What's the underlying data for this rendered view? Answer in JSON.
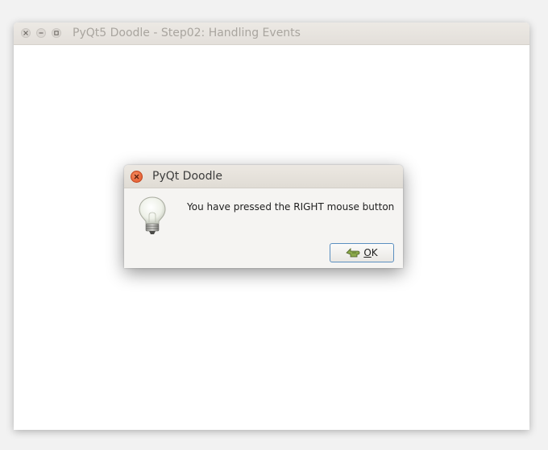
{
  "main_window": {
    "title": "PyQt5 Doodle - Step02: Handling Events",
    "buttons": {
      "close_icon": "close-icon",
      "minimize_icon": "minimize-icon",
      "maximize_icon": "maximize-icon"
    }
  },
  "dialog": {
    "title": "PyQt Doodle",
    "message": "You have pressed the RIGHT mouse button",
    "icon": "lightbulb-icon",
    "ok_button": {
      "mnemonic": "O",
      "rest": "K",
      "icon": "ok-hand-icon"
    }
  },
  "colors": {
    "dialog_close_red": "#e0552a",
    "button_focus_border": "#5b8fc0"
  }
}
